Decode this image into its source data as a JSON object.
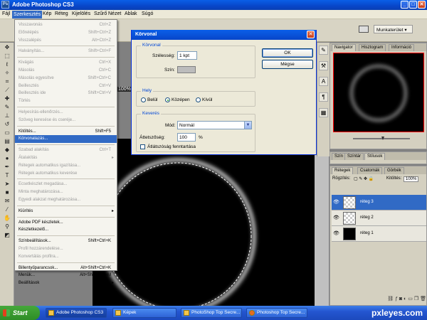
{
  "app": {
    "title": "Adobe Photoshop CS3",
    "logo_text": "Ps"
  },
  "window_buttons": [
    "_",
    "□",
    "✕"
  ],
  "menubar": [
    "Fájl",
    "Szerkesztés",
    "Kép",
    "Réteg",
    "Kijelölés",
    "Szűrő",
    "Nézet",
    "Ablak",
    "Súgó"
  ],
  "workspace": {
    "label": "Munkaterület"
  },
  "zoom": "100%",
  "edit_menu": [
    {
      "label": "Visszavonás",
      "shortcut": "Ctrl+Z"
    },
    {
      "label": "Előrelépés",
      "shortcut": "Shift+Ctrl+Z"
    },
    {
      "label": "Visszalépés",
      "shortcut": "Alt+Ctrl+Z"
    },
    {
      "sep": true
    },
    {
      "label": "Halványítás...",
      "shortcut": "Shift+Ctrl+F"
    },
    {
      "sep": true
    },
    {
      "label": "Kivágás",
      "shortcut": "Ctrl+X"
    },
    {
      "label": "Másolás",
      "shortcut": "Ctrl+C"
    },
    {
      "label": "Másolás egyesítve",
      "shortcut": "Shift+Ctrl+C"
    },
    {
      "label": "Beillesztés",
      "shortcut": "Ctrl+V"
    },
    {
      "label": "Beillesztés ide",
      "shortcut": "Shift+Ctrl+V"
    },
    {
      "label": "Törlés",
      "shortcut": ""
    },
    {
      "sep": true
    },
    {
      "label": "Helyesírás-ellenőrzés...",
      "shortcut": ""
    },
    {
      "label": "Szöveg keresése és cseréje...",
      "shortcut": ""
    },
    {
      "sep": true
    },
    {
      "label": "Kitöltés...",
      "shortcut": "Shift+F5",
      "enabled": true
    },
    {
      "label": "Körvonalazás...",
      "shortcut": "",
      "enabled": true,
      "highlight": true
    },
    {
      "sep": true
    },
    {
      "label": "Szabad alakítás",
      "shortcut": "Ctrl+T"
    },
    {
      "label": "Átalakítás",
      "shortcut": "",
      "arrow": true
    },
    {
      "label": "Rétegek automatikus igazítása...",
      "shortcut": ""
    },
    {
      "label": "Rétegek automatikus keverése",
      "shortcut": ""
    },
    {
      "sep": true
    },
    {
      "label": "Ecsetkészlet megadása...",
      "shortcut": ""
    },
    {
      "label": "Minta meghatározása...",
      "shortcut": ""
    },
    {
      "label": "Egyedi alakzat meghatározása...",
      "shortcut": ""
    },
    {
      "sep": true
    },
    {
      "label": "Kiürítés",
      "shortcut": "",
      "arrow": true,
      "enabled": true
    },
    {
      "sep": true
    },
    {
      "label": "Adobe PDF készletek...",
      "shortcut": "",
      "enabled": true
    },
    {
      "label": "Készletkezelő...",
      "shortcut": "",
      "enabled": true
    },
    {
      "sep": true
    },
    {
      "label": "Színbeállítások...",
      "shortcut": "Shift+Ctrl+K",
      "enabled": true
    },
    {
      "label": "Profil hozzárendelése...",
      "shortcut": ""
    },
    {
      "label": "Konvertálás profilra...",
      "shortcut": ""
    },
    {
      "sep": true
    },
    {
      "label": "Billentyűparancsok...",
      "shortcut": "Alt+Shift+Ctrl+K",
      "enabled": true
    },
    {
      "label": "Menük...",
      "shortcut": "Alt+Shift+Ctrl+M",
      "enabled": true
    },
    {
      "label": "Beállítások",
      "shortcut": "",
      "arrow": true,
      "enabled": true
    }
  ],
  "dialog": {
    "title": "Körvonal",
    "stroke_group": "Körvonal",
    "width_label": "Szélesség:",
    "width_value": "1 kpt",
    "color_label": "Szín:",
    "location_group": "Hely",
    "location_options": [
      "Belül",
      "Középen",
      "Kívül"
    ],
    "location_selected": 1,
    "blend_group": "Keverés",
    "mode_label": "Mód:",
    "mode_value": "Normál",
    "opacity_label": "Áttetszőség:",
    "opacity_value": "100",
    "opacity_unit": "%",
    "preserve_label": "Átlátszóság fenntartása",
    "ok": "OK",
    "cancel": "Mégse"
  },
  "navigator_tabs": [
    "Navigator",
    "Hisztogram",
    "Információ"
  ],
  "color_tabs": [
    "Szín",
    "Színtár",
    "Stílusok"
  ],
  "layers_tabs": [
    "Rétegek",
    "Csatornák",
    "Görbék"
  ],
  "layers_controls": {
    "lock": "Rögzítés:",
    "fill": "Kitöltés:",
    "fill_value": "100%"
  },
  "layers": [
    {
      "name": "réteg 3",
      "selected": true,
      "thumb": "transparent"
    },
    {
      "name": "réteg 2",
      "selected": false,
      "thumb": "transparent"
    },
    {
      "name": "réteg 1",
      "selected": false,
      "thumb": "black"
    }
  ],
  "taskbar": {
    "start": "Start",
    "tasks": [
      "Adobe Photoshop CS3",
      "Képek",
      "PhotoShop Top Secre...",
      "Photoshop Top Secre..."
    ],
    "watermark": "pxleyes.com"
  }
}
